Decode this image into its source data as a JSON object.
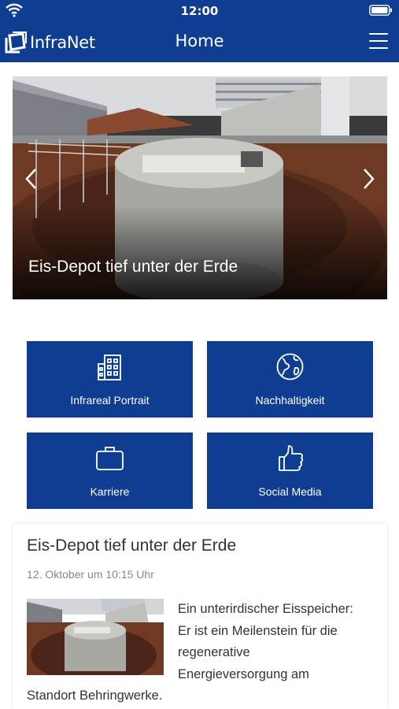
{
  "status": {
    "time": "12:00"
  },
  "nav": {
    "logo_text": "InfraNet",
    "title": "Home"
  },
  "hero": {
    "caption": "Eis-Depot tief unter der Erde"
  },
  "tiles": [
    {
      "label": "Infrareal Portrait",
      "icon": "building-icon"
    },
    {
      "label": "Nachhaltigkeit",
      "icon": "globe-icon"
    },
    {
      "label": "Karriere",
      "icon": "briefcase-icon"
    },
    {
      "label": "Social Media",
      "icon": "thumbs-up-icon"
    }
  ],
  "article": {
    "title": "Eis-Depot tief unter der Erde",
    "date": "12. Oktober um 10:15 Uhr",
    "text": "Ein unterirdischer Eisspeicher: Er ist ein Meilenstein für die regenerative Energieversorgung am Standort Behringwerke."
  },
  "colors": {
    "brand": "#0e3d91",
    "background": "#ffffff"
  }
}
